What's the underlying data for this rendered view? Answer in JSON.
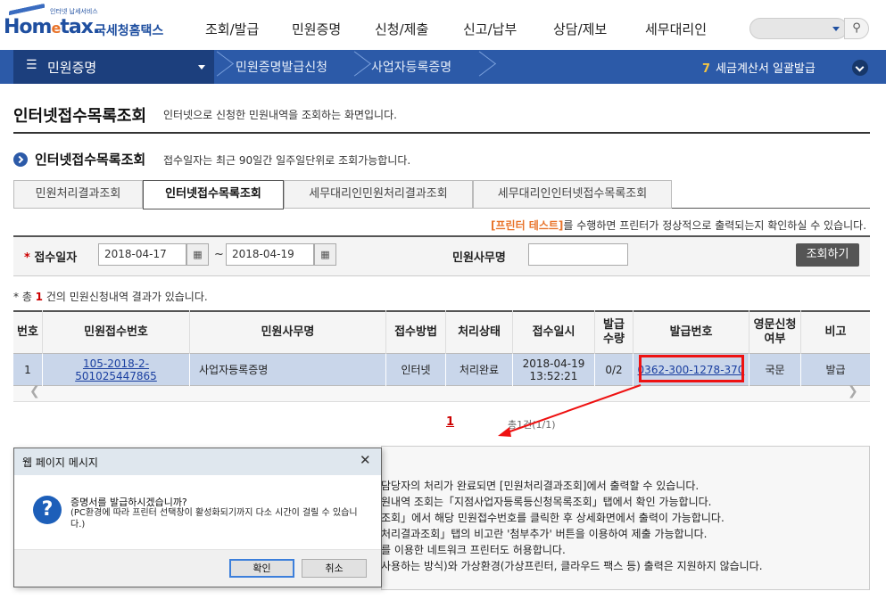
{
  "header": {
    "logo_small": "인터넷 납세서비스",
    "logo_en_a": "Hom",
    "logo_en_e": "e",
    "logo_en_b": "tax.",
    "logo_kr": "국세청홈택스",
    "menu": [
      "조회/발급",
      "민원증명",
      "신청/제출",
      "신고/납부",
      "상담/제보",
      "세무대리인"
    ]
  },
  "navbar": {
    "section": "민원증명",
    "crumbs": [
      "민원증명발급신청",
      "사업자등록증명"
    ],
    "right_num": "7",
    "right_label": "세금계산서 일괄발급"
  },
  "page": {
    "title": "인터넷접수목록조회",
    "desc": "인터넷으로 신청한 민원내역을 조회하는 화면입니다.",
    "section_title": "인터넷접수목록조회",
    "section_desc": "접수일자는 최근 90일간 일주일단위로 조회가능합니다."
  },
  "tabs": [
    "민원처리결과조회",
    "인터넷접수목록조회",
    "세무대리인민원처리결과조회",
    "세무대리인인터넷접수목록조회"
  ],
  "printer_note": {
    "link": "[프린터 테스트]",
    "text": "를 수행하면 프린터가 정상적으로 출력되는지 확인하실 수 있습니다."
  },
  "search": {
    "date_label": "접수일자",
    "date_from": "2018-04-17",
    "date_to": "2018-04-19",
    "tilde": "~",
    "office_label": "민원사무명",
    "office_value": "",
    "query_button": "조회하기"
  },
  "result": {
    "prefix": "* 총 ",
    "count": "1",
    "suffix": " 건의 민원신청내역 결과가 있습니다."
  },
  "table": {
    "headers": [
      "번호",
      "민원접수번호",
      "민원사무명",
      "접수방법",
      "처리상태",
      "접수일시",
      "발급\n수량",
      "발급번호",
      "영문신청\n여부",
      "비고"
    ],
    "rows": [
      [
        "1",
        "105-2018-2-501025447865",
        "사업자등록증명",
        "인터넷",
        "처리완료",
        "2018-04-19\n13:52:21",
        "0/2",
        "0362-300-1278-370",
        "국문",
        "발급"
      ]
    ]
  },
  "pager": {
    "page": "1",
    "total": "총1건(1/1)"
  },
  "info_lines": [
    "담당자의 처리가 완료되면 [민원처리결과조회]에서 출력할 수 있습니다.",
    "원내역 조회는「지점사업자등록등신청목록조회」탭에서 확인 가능합니다.",
    "조회」에서 해당 민원접수번호를 클릭한 후 상세화면에서 출력이 가능합니다.",
    "처리결과조회」탭의 비고란 '첨부추가' 버튼을 이용하여 제출 가능합니다.",
    "를 이용한 네트워크 프린터도 허용합니다.",
    "사용하는 방식)와 가상환경(가상프린터, 클라우드 팩스 등) 출력은 지원하지 않습니다."
  ],
  "dialog": {
    "title": "웹 페이지 메시지",
    "close": "✕",
    "icon": "?",
    "message": "증명서를 발급하시겠습니까?",
    "sub": "(PC환경에 따라 프린터 선택창이 활성화되기까지 다소 시간이 걸릴 수 있습니다.)",
    "ok": "확인",
    "cancel": "취소"
  },
  "colors": {
    "brand_blue": "#2c5aa8",
    "nav_dark": "#1c3f7d",
    "row_highlight": "#c9d6ea",
    "highlight_red": "#e11111"
  }
}
